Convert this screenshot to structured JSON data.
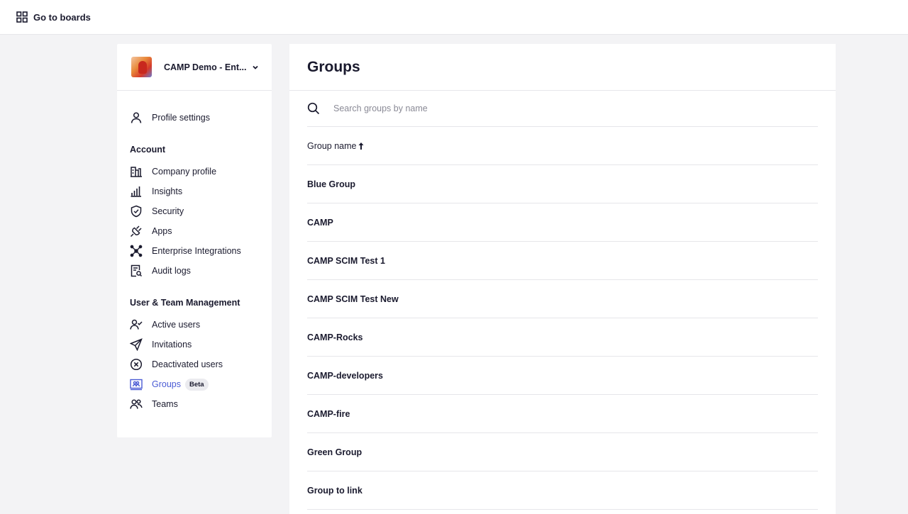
{
  "topbar": {
    "go_to_boards": "Go to boards",
    "icon": "grid-icon"
  },
  "org": {
    "name": "CAMP Demo - Ent..."
  },
  "sidebar": {
    "profile": {
      "label": "Profile settings",
      "icon": "user-icon"
    },
    "account_title": "Account",
    "account_items": [
      {
        "label": "Company profile",
        "icon": "building-icon"
      },
      {
        "label": "Insights",
        "icon": "bar-chart-icon"
      },
      {
        "label": "Security",
        "icon": "shield-check-icon"
      },
      {
        "label": "Apps",
        "icon": "plug-icon"
      },
      {
        "label": "Enterprise Integrations",
        "icon": "integrations-icon"
      },
      {
        "label": "Audit logs",
        "icon": "audit-log-icon"
      }
    ],
    "team_title": "User & Team Management",
    "team_items": [
      {
        "label": "Active users",
        "icon": "user-check-icon"
      },
      {
        "label": "Invitations",
        "icon": "paper-plane-icon"
      },
      {
        "label": "Deactivated users",
        "icon": "circle-x-icon"
      },
      {
        "label": "Groups",
        "icon": "groups-icon",
        "badge": "Beta",
        "active": true
      },
      {
        "label": "Teams",
        "icon": "team-icon"
      }
    ]
  },
  "main": {
    "title": "Groups",
    "search_placeholder": "Search groups by name",
    "column_header": "Group name",
    "sort": "ascending",
    "groups": [
      "Blue Group",
      "CAMP",
      "CAMP SCIM Test 1",
      "CAMP SCIM Test New",
      "CAMP-Rocks",
      "CAMP-developers",
      "CAMP-fire",
      "Green Group",
      "Group to link"
    ]
  },
  "colors": {
    "accent": "#4a5bd4",
    "text": "#1a1a2e",
    "background": "#f3f3f5"
  }
}
